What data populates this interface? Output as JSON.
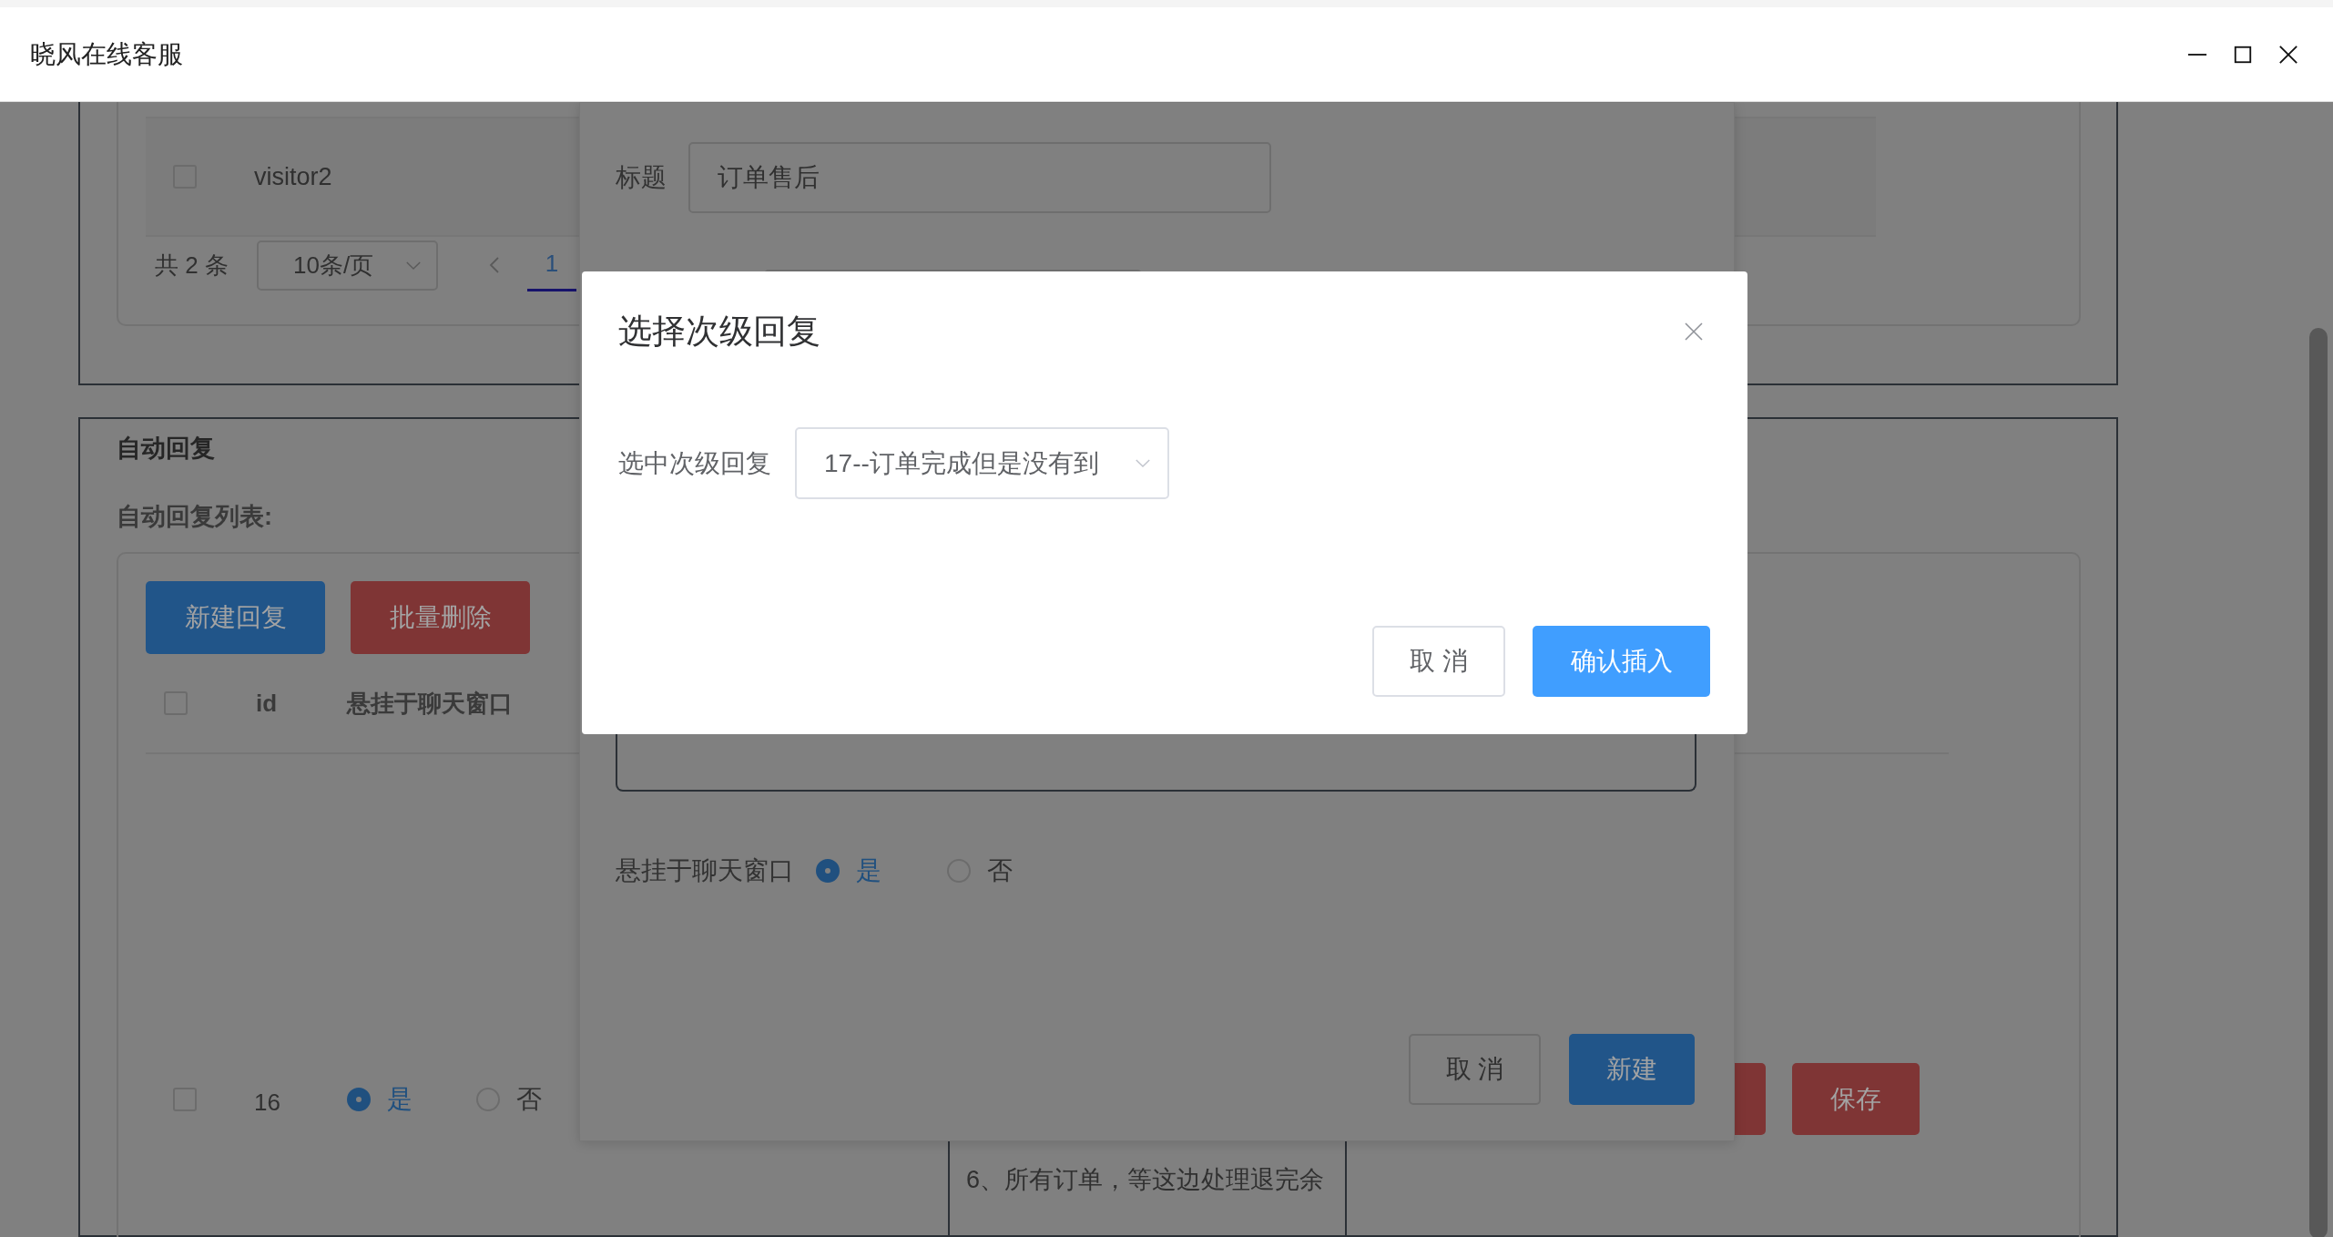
{
  "window": {
    "title": "晓风在线客服"
  },
  "visitor_table": {
    "rows": [
      {
        "name": "visitor2",
        "checked": false
      }
    ],
    "pagination": {
      "total": "共 2 条",
      "page_size": "10条/页",
      "pages": [
        {
          "label": "1",
          "selected": true
        }
      ]
    }
  },
  "auto_reply": {
    "title": "自动回复",
    "list_title": "自动回复列表:",
    "toolbar": [
      {
        "label": "新建回复",
        "kind": "primary"
      },
      {
        "label": "批量删除",
        "kind": "danger"
      }
    ],
    "columns": [
      "id",
      "悬挂于聊天窗口"
    ],
    "all_checked": false,
    "rows": [
      {
        "id": "16",
        "checked": false,
        "pin_options": [
          {
            "label": "是",
            "selected": true
          },
          {
            "label": "否",
            "selected": false
          }
        ],
        "cell": "6、所有订单，等这边处理退完余",
        "actions": [
          {
            "kind": "danger"
          },
          {
            "label": "保存",
            "kind": "danger"
          }
        ]
      }
    ]
  },
  "edit_dialog": {
    "title_label": "标题",
    "title_value": "订单售后",
    "pin_label": "悬挂于聊天窗口",
    "pin_options": [
      {
        "label": "是",
        "selected": true
      },
      {
        "label": "否",
        "selected": false
      }
    ],
    "buttons": [
      {
        "label": "取 消",
        "kind": "default"
      },
      {
        "label": "新建",
        "kind": "primary"
      }
    ]
  },
  "select_dialog": {
    "title": "选择次级回复",
    "field_label": "选中次级回复",
    "value": "17--订单完成但是没有到",
    "buttons": [
      {
        "label": "取 消",
        "kind": "default"
      },
      {
        "label": "确认插入",
        "kind": "primary"
      }
    ]
  }
}
